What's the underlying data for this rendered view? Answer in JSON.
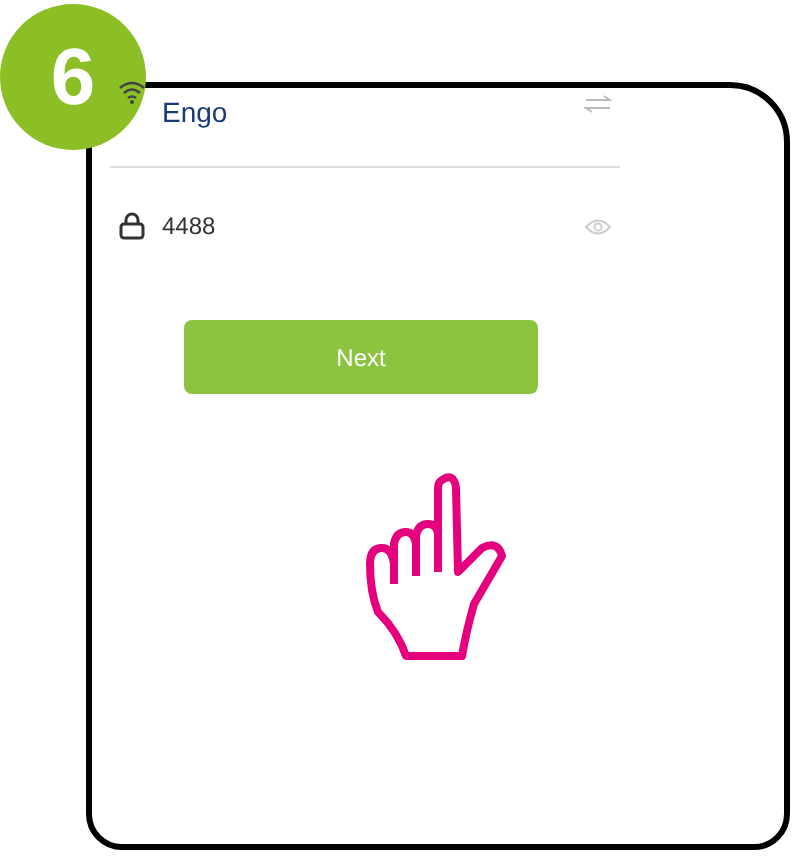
{
  "step": {
    "number": "6"
  },
  "form": {
    "ssid": {
      "value": "Engo"
    },
    "password": {
      "value": "4488"
    }
  },
  "buttons": [
    {
      "label": "Next"
    }
  ]
}
